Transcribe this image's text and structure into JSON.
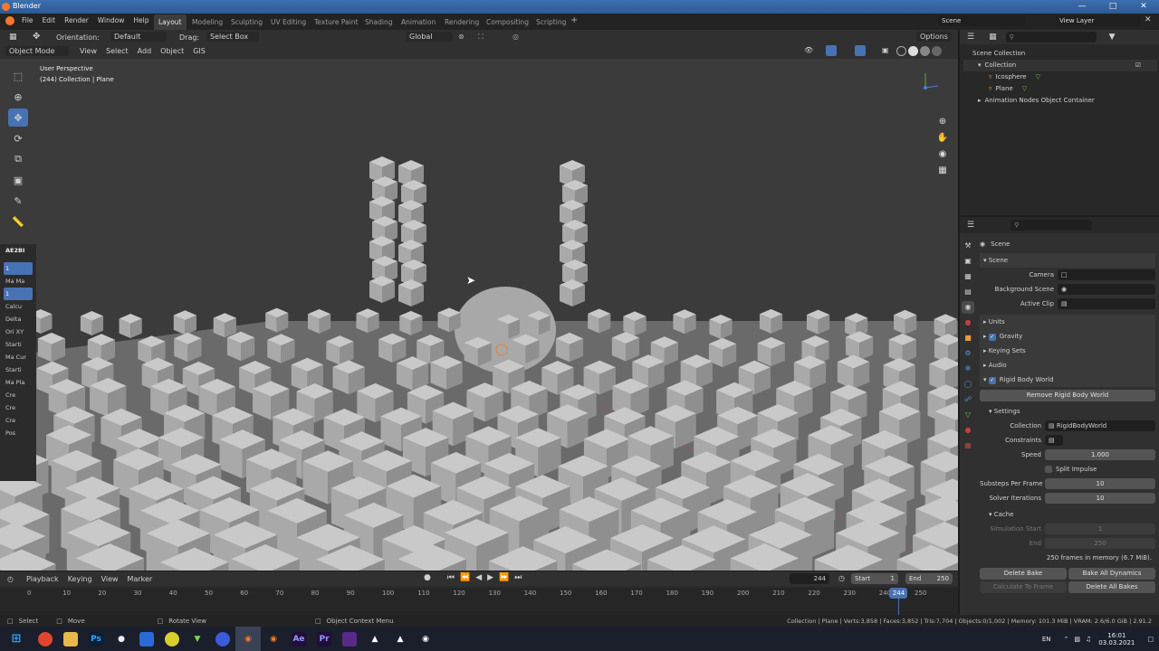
{
  "window": {
    "title": "Blender"
  },
  "menubar": {
    "items": [
      "File",
      "Edit",
      "Render",
      "Window",
      "Help"
    ]
  },
  "workspaces": [
    "Layout",
    "Modeling",
    "Sculpting",
    "UV Editing",
    "Texture Paint",
    "Shading",
    "Animation",
    "Rendering",
    "Compositing",
    "Scripting"
  ],
  "active_workspace": "Layout",
  "scene_selector": "Scene",
  "view_layer": "View Layer",
  "tool_header": {
    "orientation_label": "Orientation:",
    "orientation_value": "Default",
    "drag_label": "Drag:",
    "drag_value": "Select Box",
    "transform_orientation": "Global",
    "options": "Options"
  },
  "viewport_header": {
    "mode": "Object Mode",
    "menus": [
      "View",
      "Select",
      "Add",
      "Object",
      "GIS"
    ]
  },
  "viewport": {
    "perspective": "User Perspective",
    "collection_info": "(244) Collection | Plane"
  },
  "npanel": {
    "tab": "AE2BI",
    "items": [
      "1",
      "Ma Ma",
      "1",
      "Calcu",
      "Delta",
      "Ori XY",
      "Starti",
      "Ma Cur",
      "Starti",
      "Ma Pla",
      "Cre",
      "Cre",
      "Cre",
      "Pos"
    ]
  },
  "outliner": {
    "root": "Scene Collection",
    "items": [
      {
        "label": "Collection",
        "indent": 1
      },
      {
        "label": "Icosphere",
        "indent": 2
      },
      {
        "label": "Plane",
        "indent": 2
      },
      {
        "label": "Animation Nodes Object Container",
        "indent": 1
      }
    ]
  },
  "properties": {
    "context": "Scene",
    "scene_header": "Scene",
    "camera_label": "Camera",
    "background_scene_label": "Background Scene",
    "active_clip_label": "Active Clip",
    "panels": [
      "Units",
      "Gravity",
      "Keying Sets",
      "Audio",
      "Rigid Body World"
    ],
    "remove_rbw": "Remove Rigid Body World",
    "settings_header": "Settings",
    "collection_label": "Collection",
    "collection_value": "RigidBodyWorld",
    "constraints_label": "Constraints",
    "speed_label": "Speed",
    "speed_value": "1.000",
    "split_impulse": "Split Impulse",
    "substeps_label": "Substeps Per Frame",
    "substeps_value": "10",
    "solver_label": "Solver Iterations",
    "solver_value": "10",
    "cache_header": "Cache",
    "sim_start_label": "Simulation Start",
    "sim_start_value": "1",
    "end_label": "End",
    "end_value": "250",
    "memory": "250 frames in memory (6.7 MiB).",
    "delete_bake": "Delete Bake",
    "bake_all": "Bake All Dynamics",
    "calc_frame": "Calculate To Frame",
    "delete_all": "Delete All Bakes"
  },
  "timeline": {
    "menus": [
      "Playback",
      "Keying",
      "View",
      "Marker"
    ],
    "current_frame": "244",
    "start_label": "Start",
    "start": "1",
    "end_label": "End",
    "end": "250",
    "ticks": [
      "0",
      "10",
      "20",
      "30",
      "40",
      "50",
      "60",
      "70",
      "80",
      "90",
      "100",
      "110",
      "120",
      "130",
      "140",
      "150",
      "160",
      "170",
      "180",
      "190",
      "200",
      "210",
      "220",
      "230",
      "240",
      "250"
    ]
  },
  "statusbar": {
    "select": "Select",
    "move": "Move",
    "rotate": "Rotate View",
    "context_menu": "Object Context Menu",
    "stats": "Collection | Plane | Verts:3,858 | Faces:3,852 | Tris:7,704 | Objects:0/1,002 | Memory: 101.3 MiB | VRAM: 2.6/6.0 GiB | 2.91.2"
  },
  "taskbar": {
    "lang": "EN",
    "time": "16:01",
    "date": "03.03.2021",
    "apps": [
      "Ps",
      "Ae",
      "Pr"
    ]
  },
  "colors": {
    "accent": "#4772b3",
    "bg": "#303030",
    "viewport": "#3b3b3b"
  }
}
